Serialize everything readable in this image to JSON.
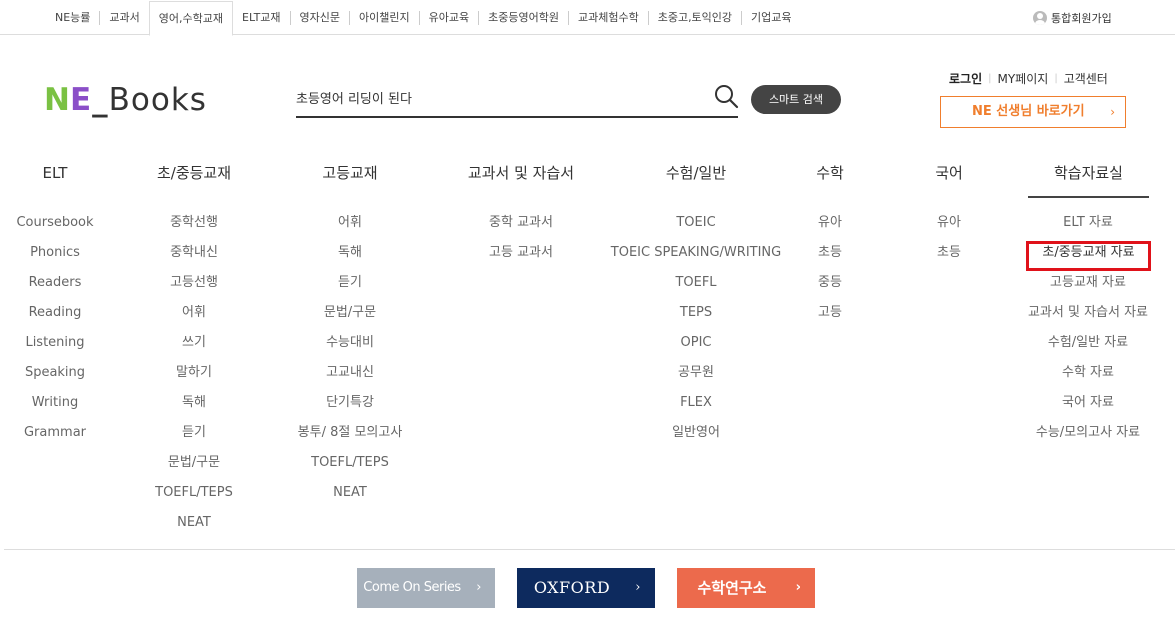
{
  "topbar": {
    "sites": [
      "NE능률",
      "교과서",
      "영어,수학교재",
      "ELT교재",
      "영자신문",
      "아이챌린지",
      "유아교육",
      "초중등영어학원",
      "교과체험수학",
      "초중고,토익인강",
      "기업교육"
    ],
    "active_site": "영어,수학교재",
    "join_label": "통합회원가입"
  },
  "header": {
    "logo": {
      "n": "N",
      "e": "E",
      "underscore": "_",
      "books": "Books"
    },
    "search": {
      "value": "초등영어 리딩이 된다",
      "smart_button": "스마트 검색"
    },
    "util": {
      "login": "로그인",
      "mypage": "MY페이지",
      "help": "고객센터"
    },
    "teacher_button": "NE 선생님 바로가기",
    "arrow": "›"
  },
  "categories": [
    {
      "label": "ELT",
      "items": [
        "Coursebook",
        "Phonics",
        "Readers",
        "Reading",
        "Listening",
        "Speaking",
        "Writing",
        "Grammar"
      ]
    },
    {
      "label": "초/중등교재",
      "items": [
        "중학선행",
        "중학내신",
        "고등선행",
        "어휘",
        "쓰기",
        "말하기",
        "독해",
        "듣기",
        "문법/구문",
        "TOEFL/TEPS",
        "NEAT"
      ]
    },
    {
      "label": "고등교재",
      "items": [
        "어휘",
        "독해",
        "듣기",
        "문법/구문",
        "수능대비",
        "고교내신",
        "단기특강",
        "봉투/ 8절 모의고사",
        "TOEFL/TEPS",
        "NEAT"
      ]
    },
    {
      "label": "교과서 및 자습서",
      "items": [
        "중학 교과서",
        "고등 교과서"
      ]
    },
    {
      "label": "수험/일반",
      "items": [
        "TOEIC",
        "TOEIC SPEAKING/WRITING",
        "TOEFL",
        "TEPS",
        "OPIC",
        "공무원",
        "FLEX",
        "일반영어"
      ]
    },
    {
      "label": "수학",
      "items": [
        "유아",
        "초등",
        "중등",
        "고등"
      ]
    },
    {
      "label": "국어",
      "items": [
        "유아",
        "초등"
      ]
    },
    {
      "label": "학습자료실",
      "items": [
        "ELT 자료",
        "초/중등교재 자료",
        "고등교재 자료",
        "교과서 및 자습서 자료",
        "수험/일반 자료",
        "수학 자료",
        "국어 자료",
        "수능/모의고사 자료"
      ],
      "highlighted_item": "초/중등교재 자료"
    }
  ],
  "banners": [
    {
      "label": "Come On Series",
      "arrow": "›"
    },
    {
      "label": "OXFORD",
      "arrow": "›"
    },
    {
      "label": "수학연구소",
      "arrow": "›"
    }
  ],
  "colors": {
    "accent_orange": "#f07e2d",
    "highlight_red": "#e0121a",
    "oxford_navy": "#0d2a5e",
    "math_coral": "#ec6a4c",
    "come_on_gray": "#a6b0bb"
  }
}
